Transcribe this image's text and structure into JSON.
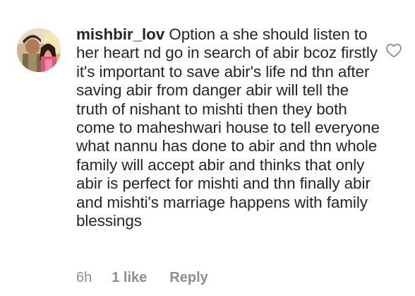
{
  "comment": {
    "username": "mishbir_lov",
    "text": "Option a she should listen to her heart nd go in search of abir bcoz firstly it's important to save abir's life nd thn after saving abir from danger abir will tell the truth of nishant to mishti then they both come to maheshwari house to tell everyone what nannu has done to abir and thn whole family will accept abir and thinks that only abir is perfect for mishti and thn finally abir and mishti's marriage happens with family blessings",
    "time": "6h",
    "likes_label": "1 like",
    "reply_label": "Reply"
  },
  "icons": {
    "avatar": "profile-avatar",
    "like": "heart-outline-icon"
  },
  "colors": {
    "text": "#262626",
    "meta": "#8e8e8e",
    "icon": "#8e8e8e"
  }
}
